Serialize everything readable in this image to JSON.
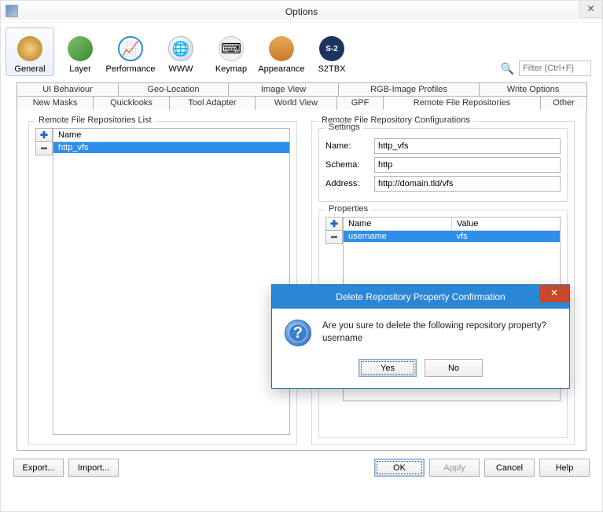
{
  "window": {
    "title": "Options"
  },
  "filter": {
    "placeholder": "Filter (Ctrl+F)"
  },
  "ribbon": [
    {
      "label": "General",
      "active": true
    },
    {
      "label": "Layer"
    },
    {
      "label": "Performance"
    },
    {
      "label": "WWW"
    },
    {
      "label": "Keymap"
    },
    {
      "label": "Appearance"
    },
    {
      "label": "S2TBX"
    }
  ],
  "tabs_row1": [
    "UI Behaviour",
    "Geo-Location",
    "Image View",
    "RGB-Image Profiles",
    "Write Options"
  ],
  "tabs_row2": [
    "New Masks",
    "Quicklooks",
    "Tool Adapter",
    "World View",
    "GPF",
    "Remote File Repositories",
    "Other"
  ],
  "active_tab": "Remote File Repositories",
  "left": {
    "legend": "Remote File Repositories List",
    "columns": [
      "Name"
    ],
    "rows": [
      {
        "name": "http_vfs",
        "selected": true
      }
    ]
  },
  "right": {
    "legend": "Remote File Repository Configurations",
    "settings": {
      "legend": "Settings",
      "name_label": "Name:",
      "name_value": "http_vfs",
      "schema_label": "Schema:",
      "schema_value": "http",
      "address_label": "Address:",
      "address_value": "http://domain.tld/vfs"
    },
    "properties": {
      "legend": "Properties",
      "columns": [
        "Name",
        "Value"
      ],
      "rows": [
        {
          "name": "username",
          "value": "vfs",
          "selected": true
        }
      ]
    }
  },
  "buttons": {
    "export": "Export...",
    "import": "Import...",
    "ok": "OK",
    "apply": "Apply",
    "cancel": "Cancel",
    "help": "Help"
  },
  "dialog": {
    "title": "Delete Repository Property Confirmation",
    "message": "Are you sure to delete the following repository property?",
    "subject": "username",
    "yes": "Yes",
    "no": "No"
  }
}
